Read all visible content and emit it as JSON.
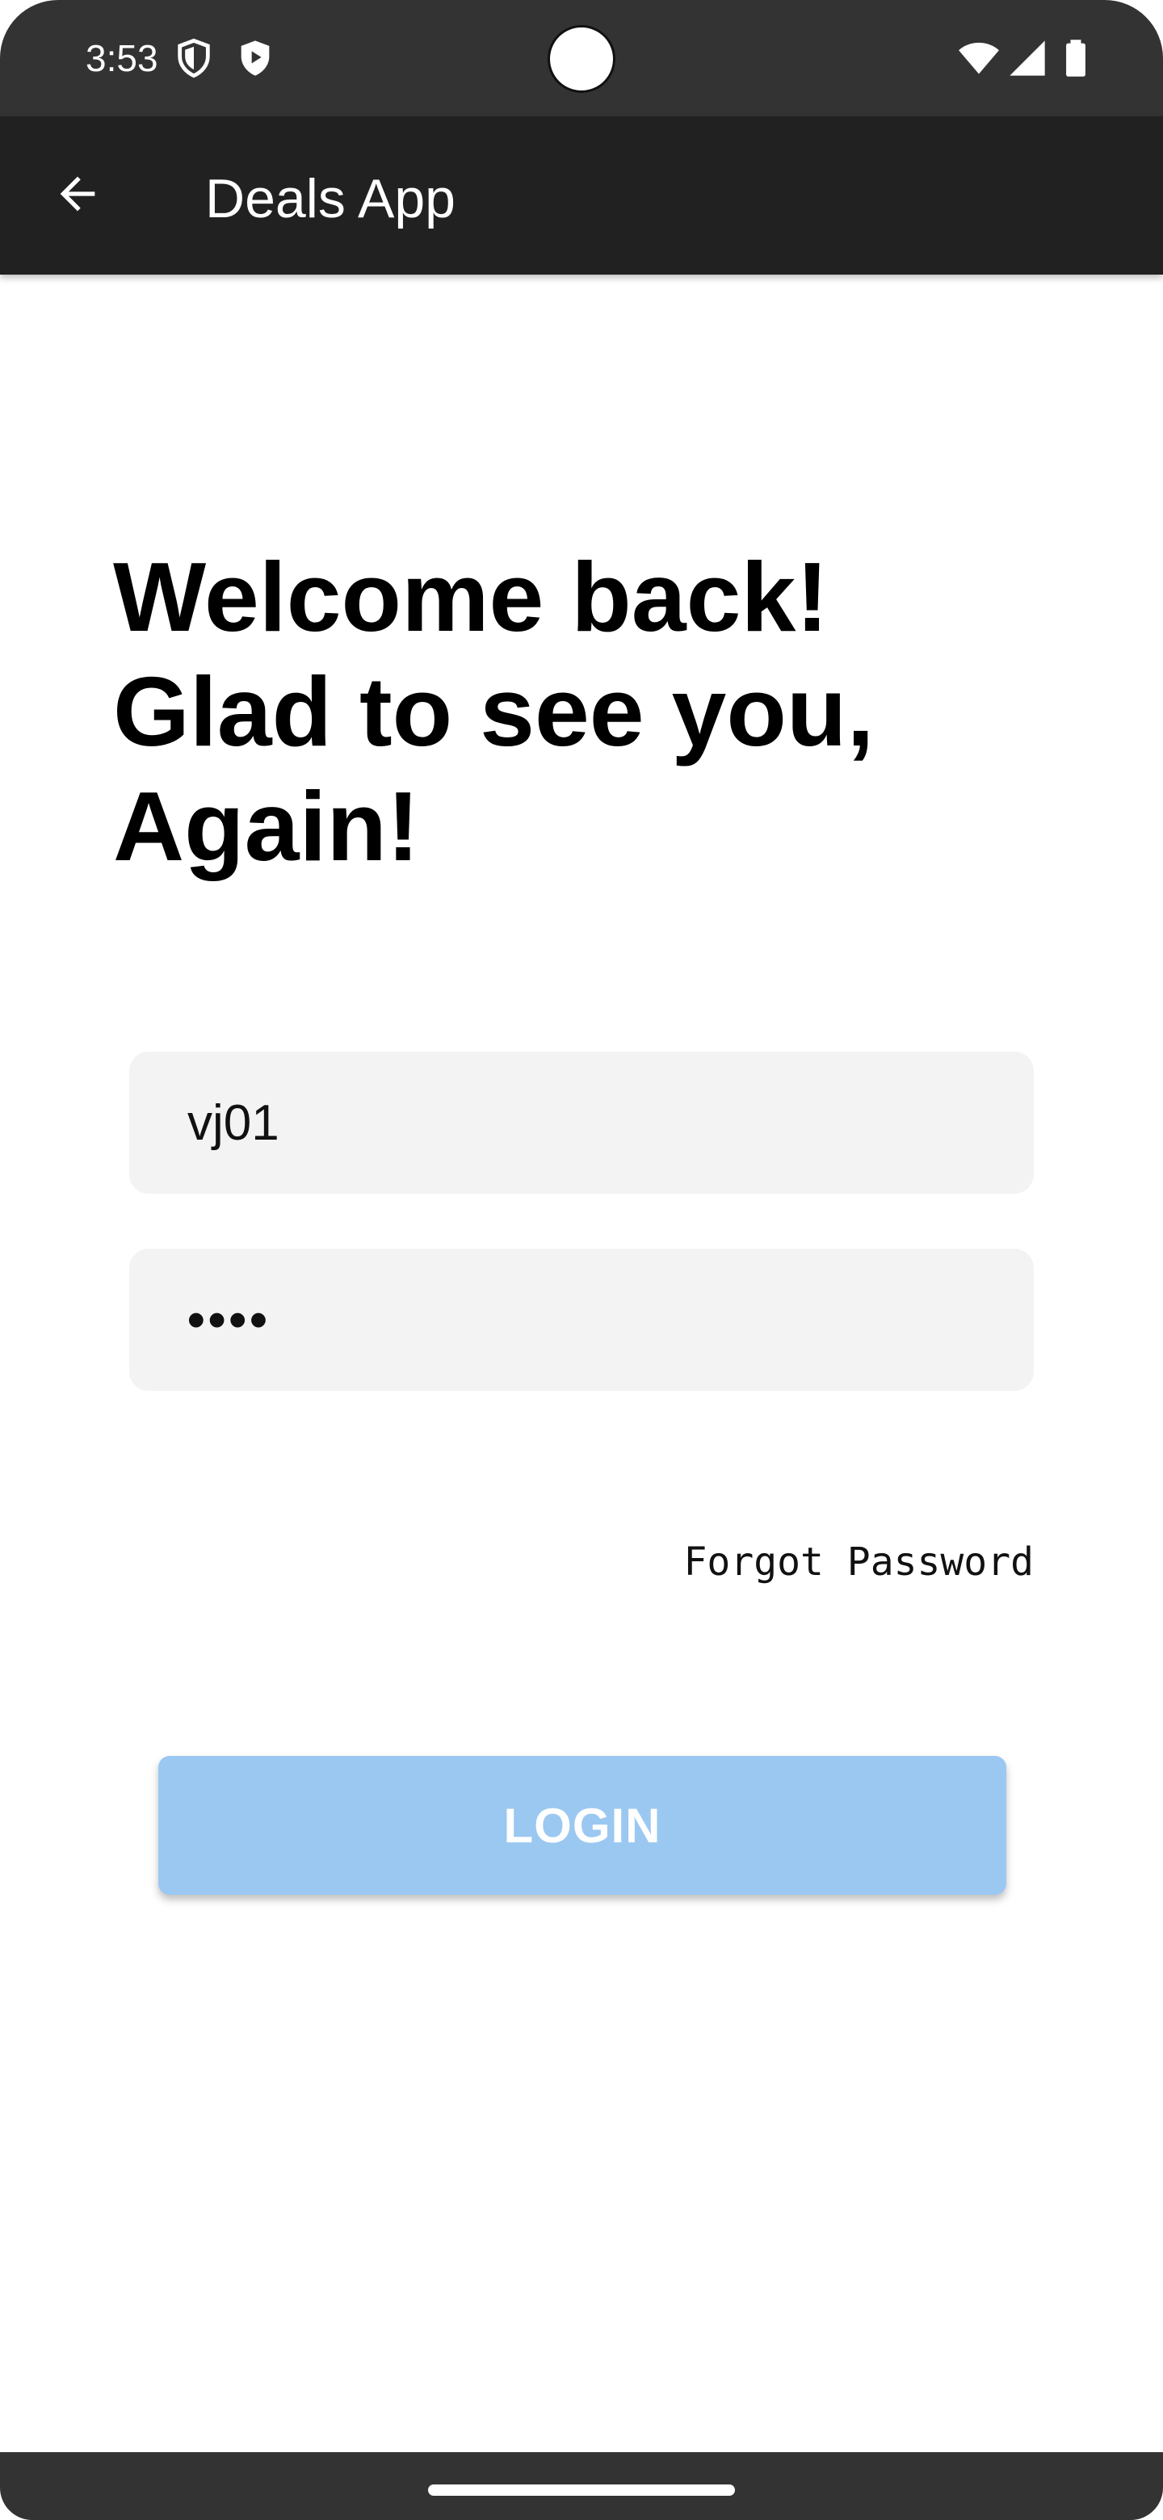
{
  "status_bar": {
    "time": "3:53",
    "left_icons": [
      "shield-icon",
      "play-protect-icon"
    ],
    "right_icons": [
      "wifi-icon",
      "cell-signal-icon",
      "battery-icon"
    ]
  },
  "app_bar": {
    "title": "Deals App",
    "back_icon": "arrow-back-icon"
  },
  "login": {
    "welcome_text": "Welcome back! Glad to see you, Again!",
    "username_value": "vj01",
    "password_value": "••••",
    "forgot_password_label": "Forgot Password",
    "login_button_label": "LOGIN"
  },
  "colors": {
    "status_bar_bg": "#333333",
    "app_bar_bg": "#212121",
    "field_bg": "#f3f3f3",
    "login_button_bg": "#9bc8f1"
  }
}
